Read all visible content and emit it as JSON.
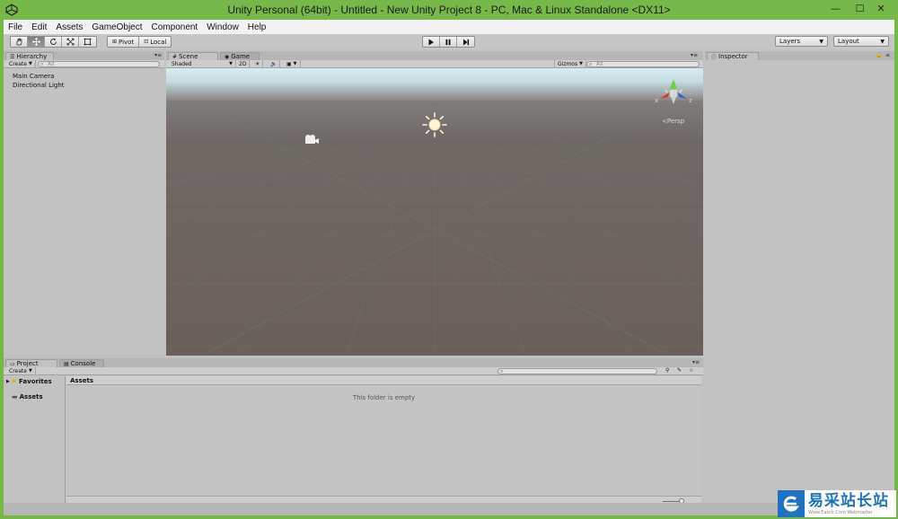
{
  "window": {
    "title": "Unity Personal (64bit) - Untitled - New Unity Project 8 - PC, Mac & Linux Standalone <DX11>",
    "minimize": "—",
    "maximize": "☐",
    "close": "✕"
  },
  "menu": [
    "File",
    "Edit",
    "Assets",
    "GameObject",
    "Component",
    "Window",
    "Help"
  ],
  "toolbar": {
    "pivot_label": "Pivot",
    "local_label": "Local",
    "layers_label": "Layers",
    "layout_label": "Layout"
  },
  "hierarchy": {
    "tab_label": "Hierarchy",
    "create_label": "Create",
    "search_placeholder": "All",
    "items": [
      "Main Camera",
      "Directional Light"
    ]
  },
  "scene": {
    "tab_label": "Scene",
    "game_tab_label": "Game",
    "shading_label": "Shaded",
    "mode_2d_label": "2D",
    "gizmos_label": "Gizmos",
    "search_placeholder": "All",
    "projection_label": "Persp",
    "axis_x": "x",
    "axis_z": "z"
  },
  "inspector": {
    "tab_label": "Inspector"
  },
  "project": {
    "tab_label": "Project",
    "console_tab_label": "Console",
    "create_label": "Create",
    "favorites_label": "Favorites",
    "assets_label": "Assets",
    "assets_header": "Assets",
    "empty_message": "This folder is empty"
  },
  "watermark": {
    "main": "易采站长站",
    "sub": "Www.Easck.Com Webmaster"
  },
  "colors": {
    "title_bar": "#77b84b",
    "panel_bg": "#c2c2c2",
    "scene_ground": "#6b625d",
    "watermark_blue": "#1d73c2"
  }
}
